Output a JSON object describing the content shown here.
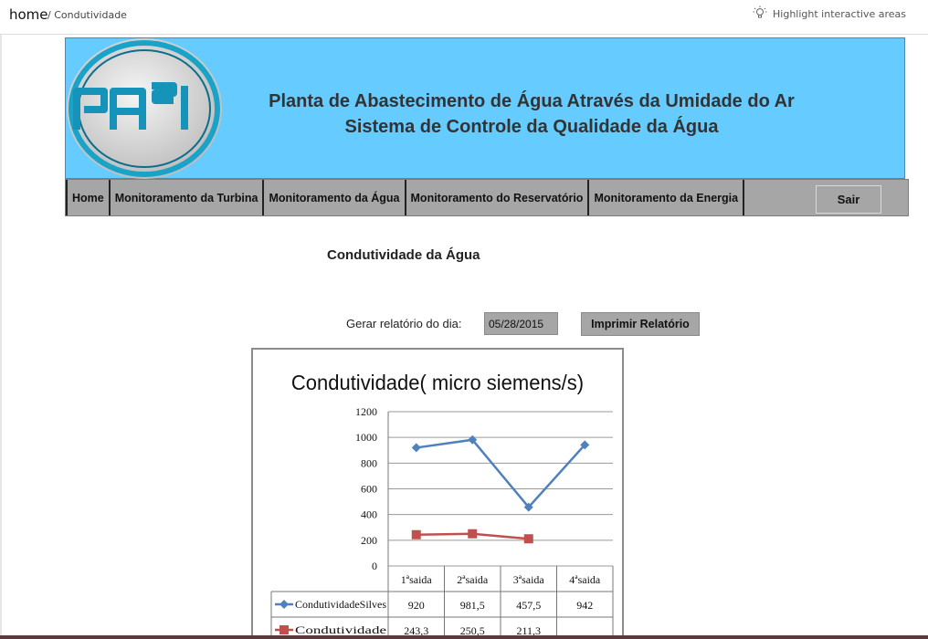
{
  "breadcrumb": {
    "home": "home",
    "current": "/ Condutividade"
  },
  "highlight": {
    "label": "Highlight interactive areas"
  },
  "banner": {
    "logo_text": "PA³1",
    "title_line1": "Planta de Abastecimento de Água Através da Umidade do Ar",
    "title_line2": "Sistema de Controle da Qualidade da Água"
  },
  "nav": {
    "items": [
      "Home",
      "Monitoramento da Turbina",
      "Monitoramento da Água",
      "Monitoramento do Reservatório",
      "Monitoramento da Energia"
    ],
    "logout": "Sair"
  },
  "page": {
    "title": "Condutividade da Água",
    "report_label": "Gerar relatório do dia:",
    "report_date": "05/28/2015",
    "print_button": "Imprimir Relatório"
  },
  "chart_data": {
    "type": "line",
    "title": "Condutividade( micro siemens/s)",
    "categories": [
      "1ªsaida",
      "2ªsaida",
      "3ªsaida",
      "4ªsaida"
    ],
    "ylim": [
      0,
      1200
    ],
    "yticks": [
      0,
      200,
      400,
      600,
      800,
      1000,
      1200
    ],
    "grid": true,
    "legend": "table-bottom",
    "series": [
      {
        "name": "CondutividadeSilves",
        "color": "#4f81bd",
        "marker": "diamond",
        "values": [
          920,
          981.5,
          457.5,
          942
        ],
        "labels": [
          "920",
          "981,5",
          "457,5",
          "942"
        ]
      },
      {
        "name": "Condutividade",
        "color": "#c0504d",
        "marker": "square",
        "values": [
          243.3,
          250.5,
          211.3,
          null
        ],
        "labels": [
          "243,3",
          "250,5",
          "211,3",
          ""
        ]
      }
    ]
  }
}
